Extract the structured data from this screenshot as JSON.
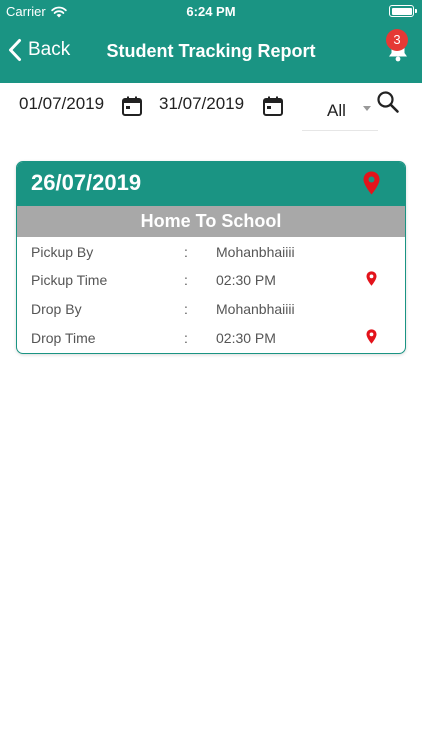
{
  "status_bar": {
    "carrier": "Carrier",
    "time": "6:24 PM"
  },
  "nav": {
    "back_label": "Back",
    "title": "Student Tracking Report",
    "notification_count": "3"
  },
  "filters": {
    "from_date": "01/07/2019",
    "to_date": "31/07/2019",
    "type_selected": "All"
  },
  "report": {
    "date": "26/07/2019",
    "trip": "Home To School",
    "rows": [
      {
        "label": "Pickup By",
        "separator": ":",
        "value": "Mohanbhaiiii"
      },
      {
        "label": "Pickup Time",
        "separator": ":",
        "value": "02:30 PM"
      },
      {
        "label": "Drop By",
        "separator": ":",
        "value": "Mohanbhaiiii"
      },
      {
        "label": "Drop Time",
        "separator": ":",
        "value": "02:30 PM"
      }
    ]
  },
  "colors": {
    "primary": "#1a9483",
    "pin": "#e3131b",
    "subheader": "#a8a8a8",
    "badge": "#e53935"
  },
  "icons": [
    "wifi-icon",
    "battery-icon",
    "chevron-left-icon",
    "bell-icon",
    "calendar-icon",
    "search-icon",
    "location-pin-icon"
  ]
}
